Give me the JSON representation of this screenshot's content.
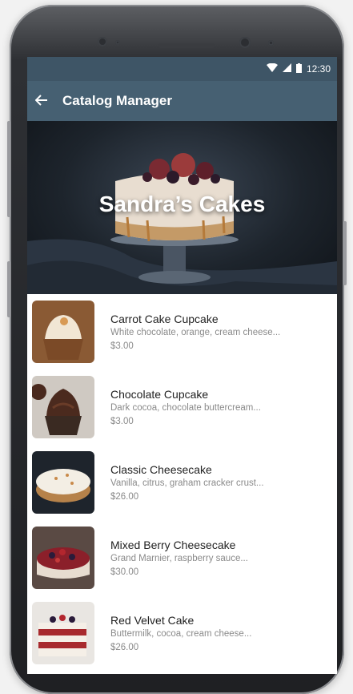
{
  "status_bar": {
    "time": "12:30",
    "wifi_icon": "wifi-icon",
    "signal_icon": "signal-icon",
    "battery_icon": "battery-icon"
  },
  "app_bar": {
    "back_icon": "arrow-left-icon",
    "title": "Catalog Manager"
  },
  "hero": {
    "title": "Sandra’s Cakes"
  },
  "colors": {
    "status_bar": "#3e5566",
    "app_bar": "#466072"
  },
  "items": [
    {
      "name": "Carrot Cake Cupcake",
      "desc": "White chocolate, orange, cream cheese...",
      "price": "$3.00"
    },
    {
      "name": "Chocolate Cupcake",
      "desc": "Dark cocoa, chocolate buttercream...",
      "price": "$3.00"
    },
    {
      "name": "Classic Cheesecake",
      "desc": "Vanilla, citrus, graham cracker crust...",
      "price": "$26.00"
    },
    {
      "name": "Mixed Berry Cheesecake",
      "desc": "Grand Marnier, raspberry sauce...",
      "price": "$30.00"
    },
    {
      "name": "Red Velvet Cake",
      "desc": "Buttermilk, cocoa, cream cheese...",
      "price": "$26.00"
    }
  ]
}
